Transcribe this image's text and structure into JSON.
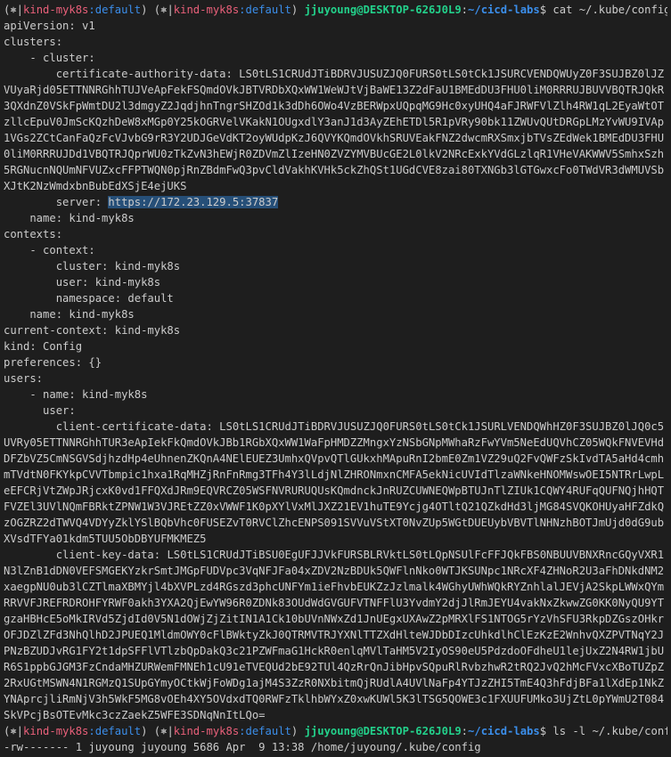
{
  "prompt": {
    "ctx_sep": "(⎈|",
    "context": "kind-myk8s",
    "ctx_ns": ":default",
    "ctx_close": ")",
    "user_host": "jjuyoung@DESKTOP-626J0L9",
    "colon": ":",
    "path": "~/cicd-labs",
    "dollar": "$"
  },
  "commands": {
    "first": "cat ~/.kube/config",
    "second": "ls -l ~/.kube/config"
  },
  "config": {
    "apiVersion": "apiVersion: v1",
    "clusters": "clusters:",
    "cluster_item": "    - cluster:",
    "cad_key": "        certificate-authority-data: ",
    "cad_val": "LS0tLS1CRUdJTiBDRVJUSUZJQ0FURS0tLS0tCk1JSURCVENDQWUyZ0F3SUJBZ0lJZVUyaRjd05ETTNNRGhhTUJVeApFekFSQmdOVkJBTVRDbXQxWW1WeWJtVjBaWE13Z2dFaU1BMEdDU3FHU0liM0RRRUJBUVVBQTRJQkR3QXdnZ0VSkFpWmtDU2l3dmgyZ2JqdjhnTngrSHZOd1k3dDh6OWo4VzBERWpxUQpqMG9Hc0xyUHQ4aFJRWFVlZlh4RW1qL2EyaWtOTzllcEpuV0JmScKQzhDeW8xMGp0Y25kOGRVelVKakN1OUgxdlY3anJ1d3AyZEhETDl5R1pVRy90bk11ZWUvQUtDRGpLMzYvWU9IVAp1VGs2ZCtCanFaQzFcVJvbG9rR3Y2UDJGeVdKT2oyWUdpKzJ6QVYKQmdOVkhSRUVEakFNZ2dwcmRXSmxjbTVsZEdWek1BMEdDU3FHU0liM0RRRUJDd1VBQTRJQprWU0zTkZvN3hEWjR0ZDVmZlIzeHN0ZVZYMVBUcGE2L0lkV2NRcExkYVdGLzlqR1VHeVAKWWV5SmhxSzh5RGNucnNQUmNFVUZxcFFPTWQN0pjRnZBdmFwQ3pvCldVakhKVHk5ckZhQSt1UGdCVE8zai80TXNGb3lGTGwxcFo0TWdVR3dWMUVSbXJtK2NzWmdxbnBubEdXSjE4ejUKS",
    "server_key": "        server: ",
    "server_val": "https://172.23.129.5:37837",
    "cluster_name": "    name: kind-myk8s",
    "contexts": "contexts:",
    "context_item": "    - context:",
    "ctx_cluster": "        cluster: kind-myk8s",
    "ctx_user": "        user: kind-myk8s",
    "ctx_namespace": "        namespace: default",
    "ctx_name": "    name: kind-myk8s",
    "current_context": "current-context: kind-myk8s",
    "kind": "kind: Config",
    "preferences": "preferences: {}",
    "users": "users:",
    "user_item": "    - name: kind-myk8s",
    "user_key": "      user:",
    "ccd_key": "        client-certificate-data: ",
    "ccd_val": "LS0tLS1CRUdJTiBDRVJUSUZJQ0FURS0tLS0tCk1JSURLVENDQWhHZ0F3SUJBZ0lJQ0c5UVRy05ETTNNRGhhTUR3eApIekFkQmdOVkJBb1RGbXQxWW1WaFpHMDZZMngxYzNSbGNpMWhaRzFwYVm5NeEdUQVhCZ05WQkFNVEVHdDFZbVZ5CmNSGVSdjhzdHp4eUhnenZKQnA4NElEUEZ3UmhxQVpvQTlGUkxhMApuRnI2bmE0Zm1VZ29uQ2FvQWFzSkIvdTA5aHd4cmhmTVdtN0FKYkpCVVTbmpic1hxa1RqMHZjRnFnRmg3TFh4Y3lLdjNlZHRONmxnCMFA5ekNicUVIdTlzaWNkeHNOMWswOEI5NTRrLwpLeEFCRjVtZWpJRjcxK0vd1FFQXdJRm9EQVRCZ05WSFNVRURUQUsKQmdnckJnRUZCUWNEQWpBTUJnTlZIUk1CQWY4RUFqQUFNQjhHQTFVZEl3UVlNQmFBRktZPNW1W3VJREtZZ0xVWWF1K0pXYlVxMlJXZ21EV1huTE9Ycjg4OTltQ21QZkdHd3ljMG84SVQKOHUyaHFZdkQzOGZRZ2dTWVQ4VDYyZklYSlBQbVhc0FUSEZvT0RVClZhcENPS091SVVuVStXT0NvZUp5WGtDUEUybVBVTlNHNzhBOTJmUjd0dG9ubXVsdTFYa01kdm5TUU5ObDBYUFMKMEZ5",
    "ckd_key": "        client-key-data: ",
    "ckd_val": "LS0tLS1CRUdJTiBSU0EgUFJJVkFURSBLRVktLS0tLQpNSUlFcFFJQkFBS0NBUUVBNXRncGQyVXR1N3lZnB1dDN0VEFSMGEKYzkrSmtJMGpFUDVpc3VqNFJFa04xZDV2NzBDUk5QWFlnNko0WTJKSUNpc1NRcXF4ZHNoR2U3aFhDNkdNM2xaegpNU0ub3lCZTlmaXBMYjl4bXVPLzd4RGszd3phcUNFYm1ieFhvbEUKZzJzlmalk4WGhyUWhWQkRYZnhlalJEVjA2SkpLWWxQYmRRVVFJREFRDROHFYRWF0akh3YXA2QjEwYW96R0ZDNk83OUdWdGVGUFVTNFFlU3YvdmY2djJlRmJEYU4vakNxZkwwZG0KK0NyQU9YTgzaHBHcE5oMkIRVd5ZjdId0V5N1dOWjZjZitIN1A1Ck10bUVnNWxZd1JnUEgxUXAwZ2pMRXlFS1NTOG5rYzVhSFU3RkpDZGszOHkrOFJDZlZFd3NhQlhD2JPUEQ1MldmOWY0cFlBWktyZkJ0QTRMVTRJYXNlTTZXdHlteWJDbDIzcUhkdlhClEzKzE2WnhvQXZPVTNqY2JPNzBZUDJvRG1FY2t1dpSFFlVTlzbQpDakQ3c21PZWFmaG1HckR0enlqMVlTaHM5V2IyOS90eU5PdzdoOFdheU1lejUxZ2N4RW1jbUR6S1ppbGJGM3FzCndaMHZURWemFMNEh1cU91eTVEQUd2bE92TUl4QzRrQnJibHpvSQpuRlRvbzhwR2tRQ2JvQ2hMcFVxcXBoTUZpZ2RxUGtMSWN4N1RGMzQ1SUpGYmyOCtkWjFoWDg1ajM4S3ZzR0NXbitmQjRUdlA4UVlNaFp4YTJzZHI5TmE4Q3hFdjBFa1lXdEp1NkZYNAprcjliRmNjV3h5WkF5MG8vOEh4XY5OVdxdTQ0RWFzTklhbWYxZ0xwKUWl5K3lTSG5QOWE3c1FXUUFUMko3UjZtL0pYWmU2T084SkVPcjBsOTEvMkc3czZaekZ5WFE3SDNqNnItLQo="
  },
  "ls_output": "-rw------- 1 juyoung juyoung 5686 Apr  9 13:38 /home/juyoung/.kube/config"
}
